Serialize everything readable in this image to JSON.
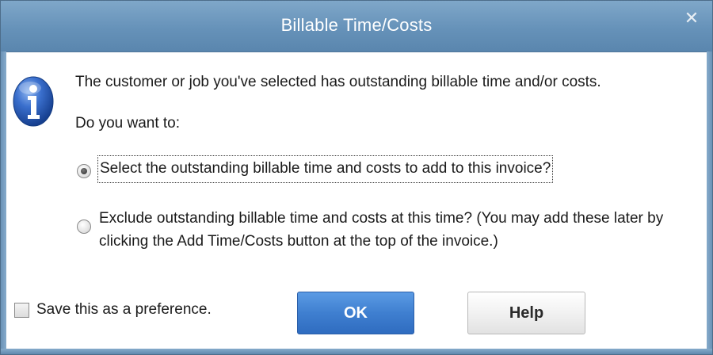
{
  "window": {
    "title": "Billable Time/Costs",
    "close_label": "✕"
  },
  "icons": {
    "info": "info-icon",
    "close": "close-icon"
  },
  "message": "The customer or job you've selected has outstanding billable time and/or costs.",
  "question": "Do you want to:",
  "options": [
    {
      "label": "Select the outstanding billable time and costs to add to this invoice?",
      "selected": true
    },
    {
      "label": "Exclude outstanding billable time and costs at this time? (You may add these later by clicking the Add Time/Costs button at the top of the invoice.)",
      "selected": false
    }
  ],
  "preference": {
    "label": "Save this as a preference.",
    "checked": false
  },
  "buttons": {
    "ok": "OK",
    "help": "Help"
  },
  "colors": {
    "titlebar": "#6692b9",
    "ok_button": "#3f7fd0",
    "info_icon": "#2457b8"
  }
}
